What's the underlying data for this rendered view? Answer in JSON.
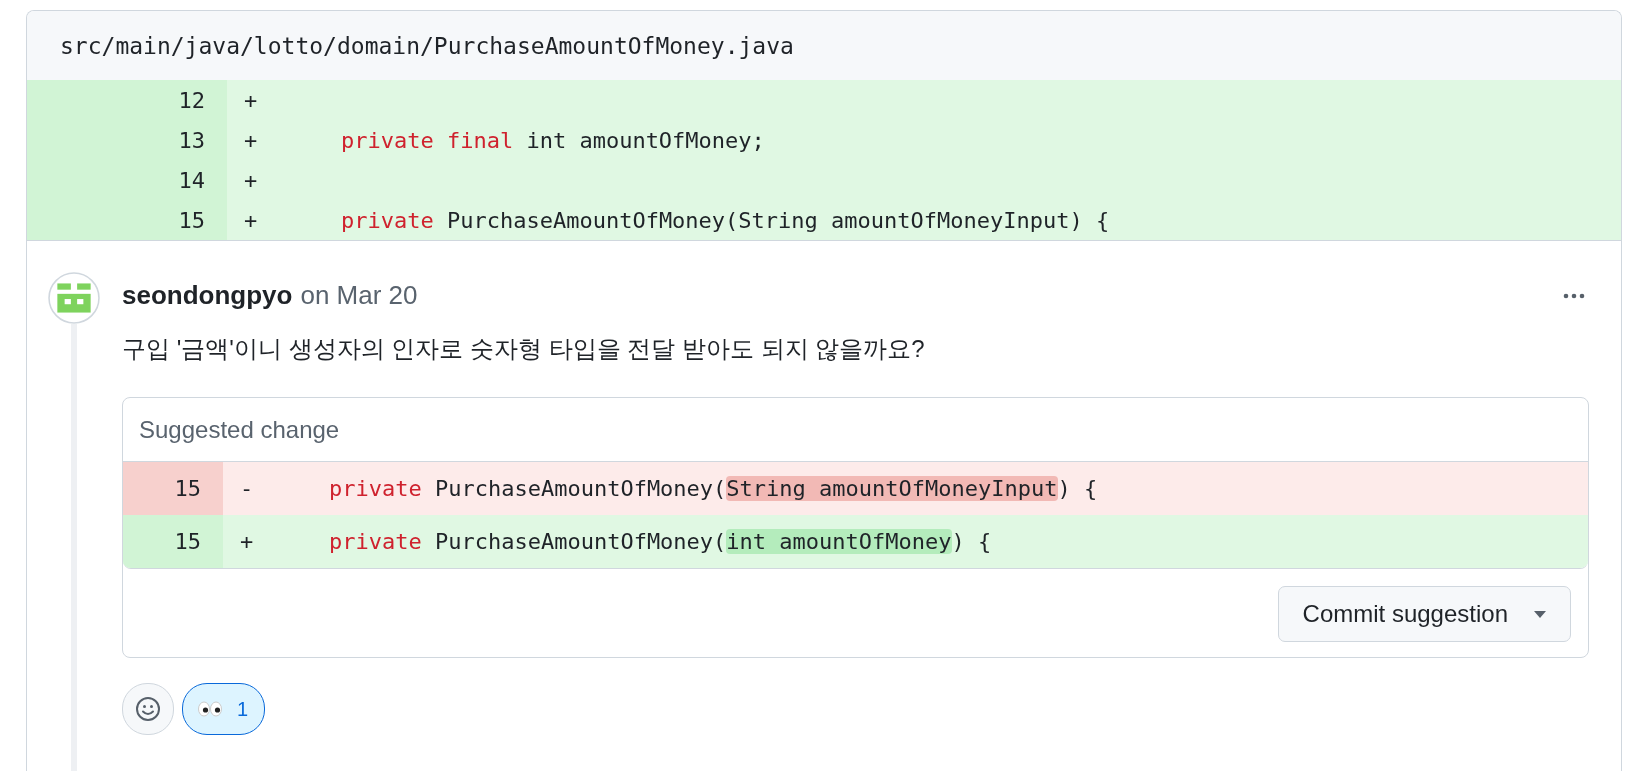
{
  "file": {
    "path": "src/main/java/lotto/domain/PurchaseAmountOfMoney.java",
    "lines": [
      {
        "number": "12",
        "sign": "+",
        "kind": "add"
      },
      {
        "number": "13",
        "sign": "+",
        "kind": "add",
        "tokens": [
          {
            "text": "private",
            "kind": "keyword"
          },
          {
            "text": "final",
            "kind": "keyword"
          },
          {
            "text": "int amountOfMoney;",
            "kind": "plain"
          }
        ]
      },
      {
        "number": "14",
        "sign": "+",
        "kind": "add"
      },
      {
        "number": "15",
        "sign": "+",
        "kind": "add",
        "tokens": [
          {
            "text": "private",
            "kind": "keyword"
          },
          {
            "text": "PurchaseAmountOfMoney(String amountOfMoneyInput) {",
            "kind": "plain"
          }
        ]
      }
    ]
  },
  "comment": {
    "author": "seondongpyo",
    "date": "on Mar 20",
    "body": "구입 '금액'이니 생성자의 인자로 숫자형 타입을 전달 받아도 되지 않을까요?",
    "suggestion": {
      "title": "Suggested change",
      "lines": [
        {
          "number": "15",
          "sign": "-",
          "kind": "del",
          "tokens": [
            {
              "text": "private",
              "kind": "keyword"
            },
            {
              "text": "PurchaseAmountOfMoney(",
              "kind": "plain"
            },
            {
              "text": "String amountOfMoneyInput",
              "kind": "highlight"
            },
            {
              "text": ") {",
              "kind": "plain"
            }
          ]
        },
        {
          "number": "15",
          "sign": "+",
          "kind": "add",
          "tokens": [
            {
              "text": "private",
              "kind": "keyword"
            },
            {
              "text": "PurchaseAmountOfMoney(",
              "kind": "plain"
            },
            {
              "text": "int amountOfMoney",
              "kind": "highlight"
            },
            {
              "text": ") {",
              "kind": "plain"
            }
          ]
        }
      ],
      "button": "Commit suggestion"
    },
    "reactions": [
      {
        "count": "1",
        "selected": true
      }
    ]
  }
}
